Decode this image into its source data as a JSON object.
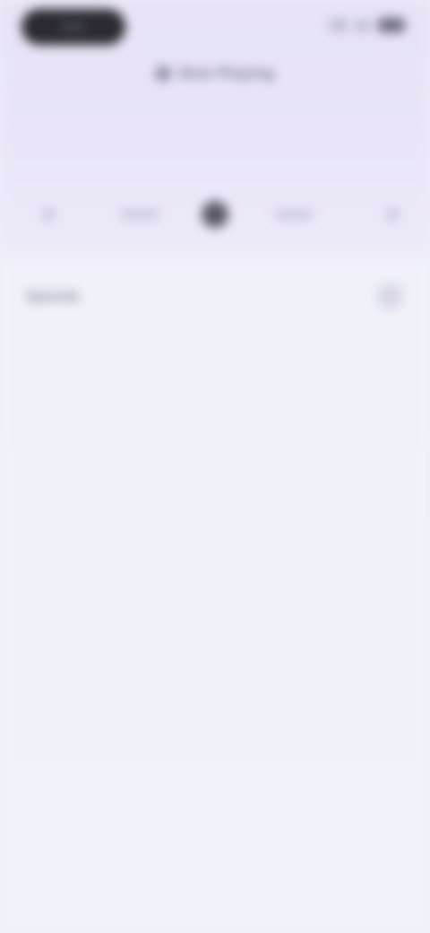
{
  "status": {
    "time": "9:41"
  },
  "header": {
    "title": "Now Playing"
  },
  "controls": {
    "prev": "previous",
    "rewind": "rewind",
    "play": "play",
    "forward": "forward",
    "next": "next"
  },
  "content": {
    "section": "Episode",
    "title": "",
    "subtitle": "",
    "body": "",
    "meta": [
      "",
      "",
      "",
      "",
      ""
    ]
  },
  "icons": {
    "status_signal": "signal-icon",
    "status_wifi": "wifi-icon",
    "status_battery": "battery-icon",
    "header": "lock-icon",
    "more": "more-icon"
  },
  "colors": {
    "background": "#ecebf7",
    "text_primary": "#3a3945",
    "text_muted": "#b8b6c6"
  }
}
